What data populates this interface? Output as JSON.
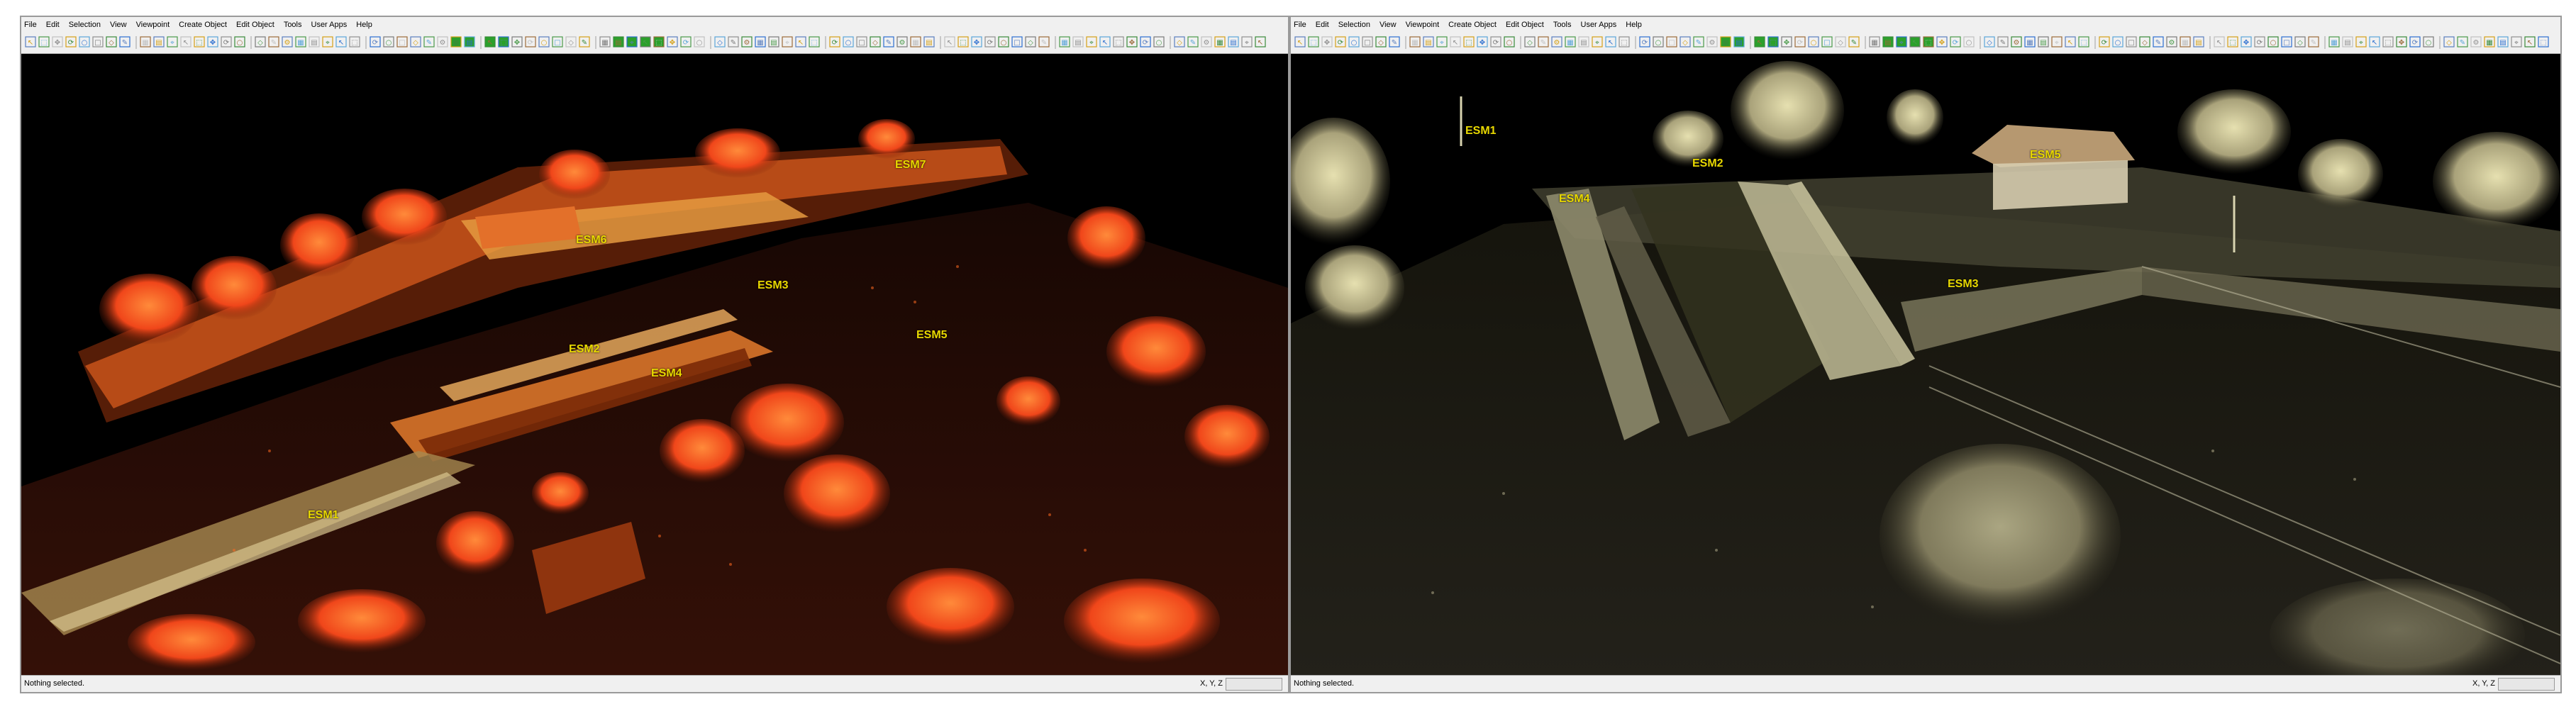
{
  "windows": [
    {
      "menu": [
        "File",
        "Edit",
        "Selection",
        "View",
        "Viewpoint",
        "Create Object",
        "Edit Object",
        "Tools",
        "User Apps",
        "Help"
      ],
      "status": "Nothing selected.",
      "coords": "X, Y, Z",
      "markers": [
        "ESM7",
        "ESM6",
        "ESM3",
        "ESM2",
        "ESM5",
        "ESM4",
        "ESM1"
      ]
    },
    {
      "menu": [
        "File",
        "Edit",
        "Selection",
        "View",
        "Viewpoint",
        "Create Object",
        "Edit Object",
        "Tools",
        "User Apps",
        "Help"
      ],
      "status": "Nothing selected.",
      "coords": "X, Y, Z",
      "markers": [
        "ESM1",
        "ESM2",
        "ESM4",
        "ESM5",
        "ESM3"
      ]
    }
  ],
  "colors": {
    "marker": "#e8d800",
    "cloud_left": "#ff5a14",
    "cloud_right": "#c9c59a"
  }
}
